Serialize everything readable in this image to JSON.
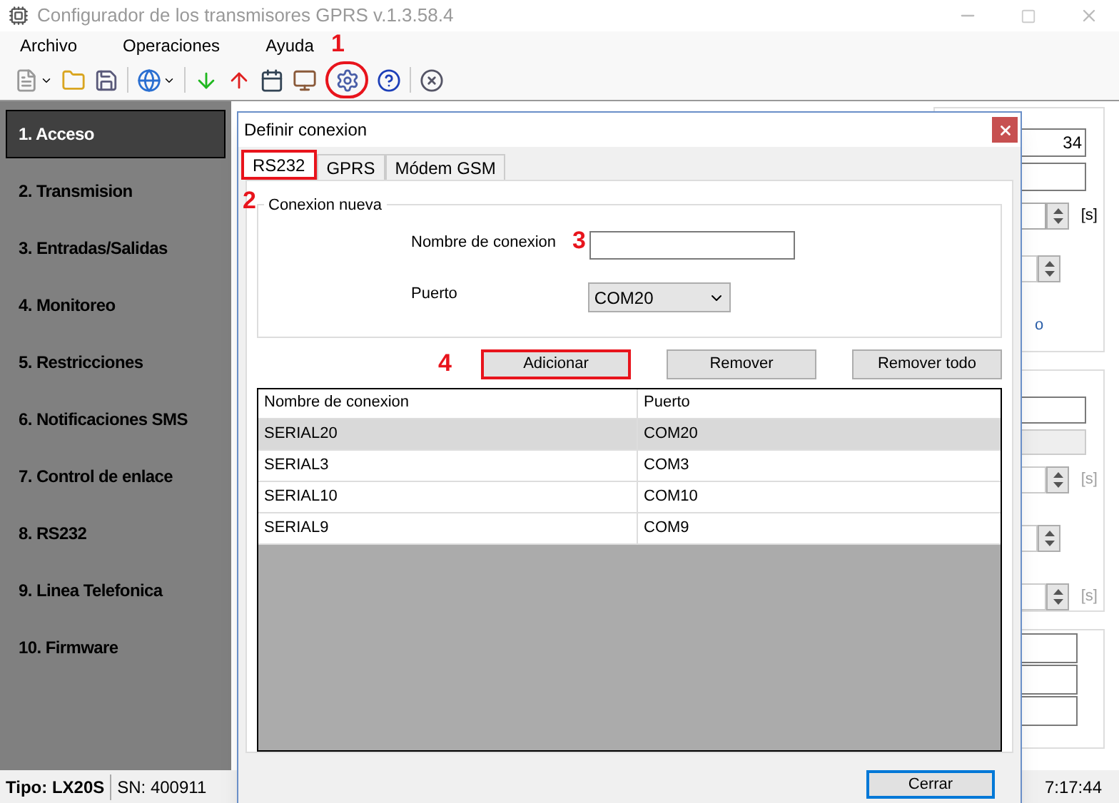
{
  "window": {
    "title": "Configurador de los transmisores GPRS v.1.3.58.4"
  },
  "menu": [
    "Archivo",
    "Operaciones",
    "Ayuda"
  ],
  "annotations": [
    "1",
    "2",
    "3",
    "4"
  ],
  "sidebar": {
    "items": [
      {
        "label": "1. Acceso",
        "selected": true
      },
      {
        "label": "2. Transmision",
        "selected": false
      },
      {
        "label": "3. Entradas/Salidas",
        "selected": false
      },
      {
        "label": "4. Monitoreo",
        "selected": false
      },
      {
        "label": "5. Restricciones",
        "selected": false
      },
      {
        "label": "6. Notificaciones SMS",
        "selected": false
      },
      {
        "label": "7. Control de enlace",
        "selected": false
      },
      {
        "label": "8. RS232",
        "selected": false
      },
      {
        "label": "9. Linea Telefonica",
        "selected": false
      },
      {
        "label": "10. Firmware",
        "selected": false
      }
    ]
  },
  "background_panel": {
    "field_value": "34",
    "units": [
      {
        "text": "[s]",
        "disabled": false
      },
      {
        "text": "[s]",
        "disabled": true
      },
      {
        "text": "[s]",
        "disabled": true
      }
    ],
    "fragment": "o"
  },
  "dialog": {
    "title": "Definir conexion",
    "tabs": [
      {
        "label": "RS232",
        "selected": true
      },
      {
        "label": "GPRS",
        "selected": false
      },
      {
        "label": "Módem GSM",
        "selected": false
      }
    ],
    "group_title": "Conexion nueva",
    "name_label": "Nombre de conexion",
    "port_label": "Puerto",
    "port_value": "COM20",
    "buttons": [
      {
        "label": "Adicionar",
        "highlighted": true
      },
      {
        "label": "Remover",
        "highlighted": false
      },
      {
        "label": "Remover todo",
        "highlighted": false
      }
    ],
    "table": {
      "columns": [
        "Nombre de conexion",
        "Puerto"
      ],
      "rows": [
        {
          "cells": [
            "SERIAL20",
            "COM20"
          ],
          "selected": true
        },
        {
          "cells": [
            "SERIAL3",
            "COM3"
          ],
          "selected": false
        },
        {
          "cells": [
            "SERIAL10",
            "COM10"
          ],
          "selected": false
        },
        {
          "cells": [
            "SERIAL9",
            "COM9"
          ],
          "selected": false
        }
      ]
    },
    "close_button": "Cerrar"
  },
  "status_bar": {
    "type": "Tipo: LX20S",
    "serial": "SN: 400911",
    "time": "7:17:44"
  }
}
